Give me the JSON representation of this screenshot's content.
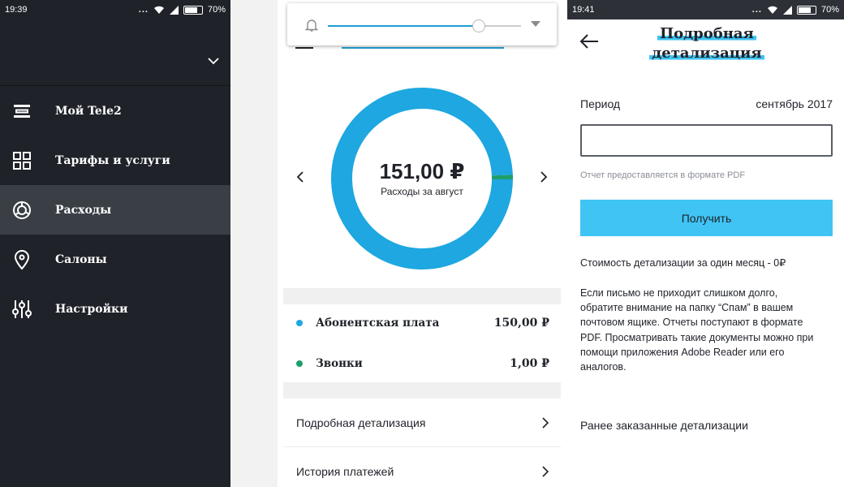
{
  "screen1": {
    "status": {
      "time": "19:39",
      "dots": "...",
      "battery": "70%"
    },
    "menu_items": [
      {
        "label": "Мой Tele2",
        "icon": "tele2-logo-icon",
        "active": false
      },
      {
        "label": "Тарифы и услуги",
        "icon": "grid-icon",
        "active": false
      },
      {
        "label": "Расходы",
        "icon": "pie-chart-icon",
        "active": true
      },
      {
        "label": "Салоны",
        "icon": "location-pin-icon",
        "active": false
      },
      {
        "label": "Настройки",
        "icon": "sliders-icon",
        "active": false
      }
    ]
  },
  "screen2": {
    "amount": "151,00 ₽",
    "amount_caption": "Расходы за август",
    "brightness_level": 0.78,
    "donut": {
      "values": [
        150.0,
        1.0
      ],
      "colors": [
        "#1ea7e0",
        "#1e9e6b"
      ]
    },
    "expenses": [
      {
        "name": "Абонентская плата",
        "value": "150,00 ₽",
        "color": "#1ea7e0"
      },
      {
        "name": "Звонки",
        "value": "1,00 ₽",
        "color": "#1e9e6b"
      }
    ],
    "links": [
      {
        "label": "Подробная детализация"
      },
      {
        "label": "История платежей"
      }
    ]
  },
  "screen3": {
    "status": {
      "time": "19:41",
      "dots": "...",
      "battery": "70%"
    },
    "title_line1": "Подробная",
    "title_line2": "детализация",
    "period_label": "Период",
    "period_value": "сентябрь 2017",
    "email_value": "",
    "hint": "Отчет предоставляется в формате PDF",
    "button_label": "Получить",
    "cost_text": "Стоимость детализации за один месяц - 0₽",
    "info_text": "Если письмо не приходит слишком долго, обратите внимание на папку “Спам” в вашем почтовом ящике. Отчеты поступают в формате PDF. Просматривать такие документы можно при помощи приложения Adobe Reader или его аналогов.",
    "previous_label": "Ранее заказанные детализации"
  },
  "colors": {
    "accent": "#40c4f4",
    "donut_blue": "#1ea7e0",
    "donut_green": "#1e9e6b",
    "menu_bg": "#1f2329",
    "menu_active": "#3a3f46"
  }
}
